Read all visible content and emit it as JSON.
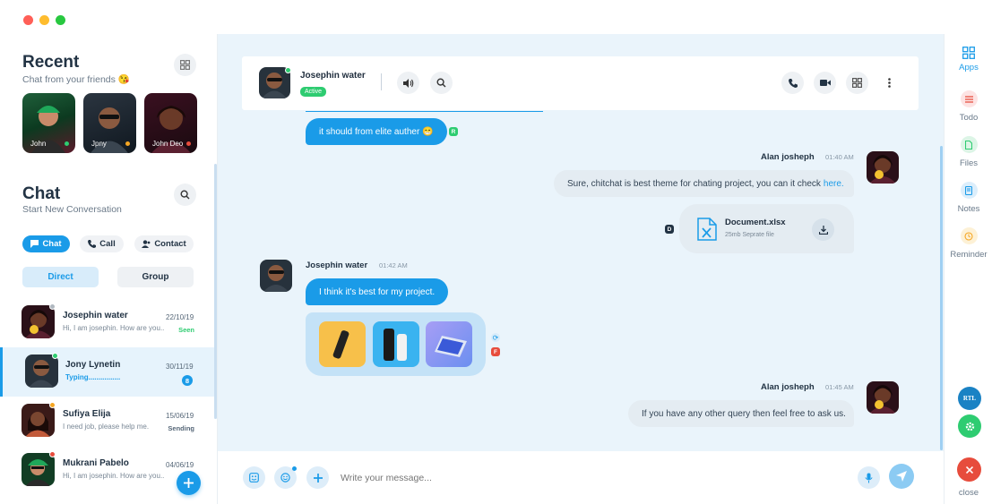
{
  "window": {
    "colors": [
      "#ff5f57",
      "#febc2e",
      "#28c840"
    ]
  },
  "recent": {
    "title": "Recent",
    "subtitle": "Chat from your friends 😘",
    "grid_icon": "grid-icon",
    "stories": [
      {
        "name": "John",
        "status_color": "#2ecc71"
      },
      {
        "name": "Jpny",
        "status_color": "#f5a623"
      },
      {
        "name": "John Deo",
        "status_color": "#e74c3c"
      }
    ]
  },
  "chat_section": {
    "title": "Chat",
    "subtitle": "Start New Conversation",
    "tabs": [
      {
        "label": "Chat",
        "icon": "chat-icon",
        "active": true
      },
      {
        "label": "Call",
        "icon": "phone-icon",
        "active": false
      },
      {
        "label": "Contact",
        "icon": "contact-icon",
        "active": false
      }
    ],
    "segments": [
      {
        "label": "Direct",
        "active": true
      },
      {
        "label": "Group",
        "active": false
      }
    ]
  },
  "conversations": [
    {
      "name": "Josephin water",
      "preview": "Hi, I am josephin. How are you..",
      "date": "22/10/19",
      "status": "Seen",
      "status_color": "#2ecc71",
      "online": "#b0b8c0"
    },
    {
      "name": "Jony Lynetin",
      "preview": "Typing................",
      "date": "30/11/19",
      "status": "8",
      "status_color": "#1a9be8",
      "online": "#2ecc71",
      "active": true
    },
    {
      "name": "Sufiya Elija",
      "preview": "I need job, please help me.",
      "date": "15/06/19",
      "status": "Sending",
      "status_color": "#556677",
      "online": "#f5a623"
    },
    {
      "name": "Mukrani Pabelo",
      "preview": "Hi, I am josephin. How are you..",
      "date": "04/06/19",
      "status": "F",
      "status_color": "#e74c3c",
      "online": "#e74c3c"
    }
  ],
  "header": {
    "name": "Josephin water",
    "status": "Active",
    "icons": [
      "speaker-icon",
      "search-icon",
      "phone-icon",
      "video-icon",
      "grid-icon",
      "more-icon"
    ]
  },
  "messages": {
    "m1": {
      "text": "it should from elite auther 😁",
      "tag": "R"
    },
    "m2": {
      "sender": "Alan josheph",
      "time": "01:40 AM",
      "text": "Sure, chitchat is best theme for chating project, you can it check ",
      "link": "here."
    },
    "m3": {
      "file_name": "Document.xlsx",
      "file_meta": "25mb Seprate file",
      "tag": "D"
    },
    "m4": {
      "sender": "Josephin water",
      "time": "01:42 AM",
      "text": "I think it's best for my project.",
      "tag": "F"
    },
    "m5": {
      "sender": "Alan josheph",
      "time": "01:45 AM",
      "text": "If you have any other query then feel free to ask us."
    }
  },
  "composer": {
    "placeholder": "Write your message..."
  },
  "right_sidebar": {
    "items": [
      {
        "label": "Apps",
        "icon": "apps-icon"
      },
      {
        "label": "Todo",
        "icon": "todo-icon"
      },
      {
        "label": "Files",
        "icon": "files-icon"
      },
      {
        "label": "Notes",
        "icon": "notes-icon"
      },
      {
        "label": "Reminder",
        "icon": "reminder-icon"
      }
    ],
    "rtl_label": "RTL",
    "close_label": "close"
  }
}
